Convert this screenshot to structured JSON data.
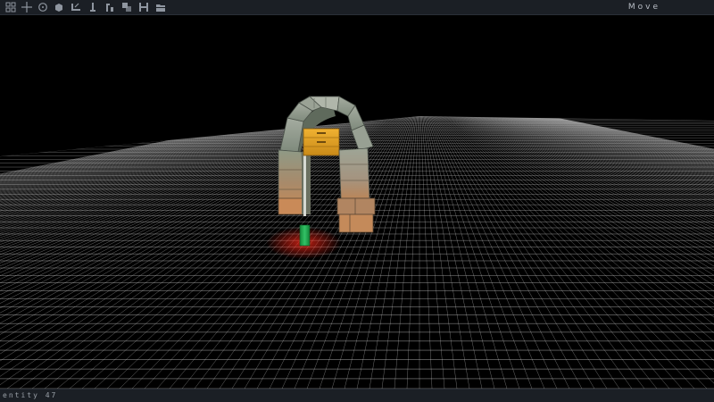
{
  "toolbar": {
    "tools": [
      {
        "icon": "select-grid-icon"
      },
      {
        "icon": "move-cross-icon"
      },
      {
        "icon": "rotate-circle-icon"
      },
      {
        "icon": "scale-cube-icon"
      },
      {
        "icon": "snap-surface-icon"
      },
      {
        "icon": "pin-icon"
      },
      {
        "icon": "tree-brush-icon"
      },
      {
        "icon": "layers-icon"
      },
      {
        "icon": "save-icon"
      },
      {
        "icon": "folder-icon"
      }
    ],
    "mode_label": "Move",
    "colors": {
      "background": "#1b1f25",
      "icon": "#8f96a0"
    }
  },
  "viewport": {
    "colors": {
      "background": "#000000",
      "grid": "#d9d9d9",
      "selection_glow": "#ff2a1a",
      "marker": "#1fa84a"
    }
  },
  "statusbar": {
    "text": "entity 47"
  }
}
